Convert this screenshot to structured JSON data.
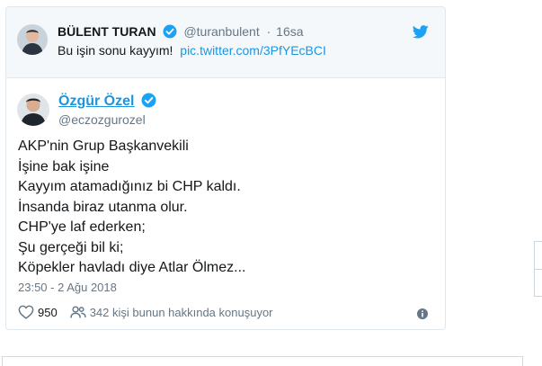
{
  "reply": {
    "name": "BÜLENT TURAN",
    "handle": "@turanbulent",
    "separator": "·",
    "time": "16sa",
    "text": "Bu işin sonu kayyım!",
    "link": "pic.twitter.com/3PfYEcBCI"
  },
  "tweet": {
    "author_name": "Özgür Özel",
    "author_handle": "@eczozgurozel",
    "lines": [
      "AKP'nin  Grup Başkanvekili",
      "İşine bak işine",
      "Kayyım atamadığınız bi CHP kaldı.",
      "İnsanda biraz utanma olur.",
      "CHP'ye laf ederken;",
      "Şu gerçeği bil ki;",
      "Köpekler havladı diye Atlar Ölmez..."
    ],
    "timestamp": "23:50 - 2 Ağu 2018",
    "likes": "950",
    "people_talking": "342 kişi bunun hakkında konuşuyor"
  },
  "colors": {
    "accent": "#1b95e0",
    "verified": "#1da1f2",
    "muted": "#657786",
    "border": "#e1e8ed",
    "quoted_bg": "#f5f8fa"
  },
  "icons": [
    "verified-icon",
    "twitter-bird-icon",
    "heart-icon",
    "people-icon",
    "info-icon"
  ]
}
